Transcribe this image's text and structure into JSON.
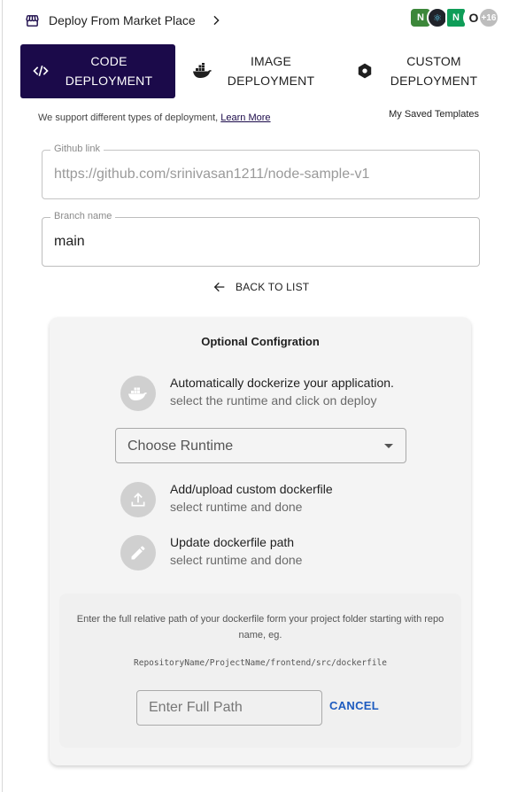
{
  "header": {
    "title": "Deploy From Market Place",
    "store_icon": "storefront-icon",
    "chevron_icon": "chevron-right-icon",
    "tech_badges": {
      "node": "N",
      "react": "⚛",
      "nginx": "N",
      "o": "O",
      "more": "+16"
    }
  },
  "tabs": [
    {
      "label": "Code Deployment",
      "icon": "code-icon",
      "active": true
    },
    {
      "label": "Image Deployment",
      "icon": "docker-icon",
      "active": false
    },
    {
      "label": "Custom Deployment",
      "icon": "hexagon-icon",
      "active": false
    }
  ],
  "support": {
    "text": "We support different types of deployment, ",
    "link": "Learn More"
  },
  "saved_templates": "My Saved Templates",
  "github_field": {
    "label": "Github link",
    "value": "https://github.com/srinivasan1211/node-sample-v1"
  },
  "branch_field": {
    "label": "Branch name",
    "value": "main"
  },
  "back_link": "BACK TO LIST",
  "optional": {
    "title": "Optional Configration",
    "options": [
      {
        "title": "Automatically dockerize your application.",
        "subtitle": "select the runtime and click on deploy",
        "icon": "docker-icon"
      },
      {
        "title": "Add/upload custom dockerfile",
        "subtitle": "select runtime and done",
        "icon": "upload-icon"
      },
      {
        "title": "Update dockerfile path",
        "subtitle": "select runtime and done",
        "icon": "pencil-icon"
      }
    ],
    "runtime_select": "Choose Runtime",
    "dockerfile_info": "Enter the full relative path of your dockerfile form your project folder starting with repo name, eg.",
    "example_path": "RepositoryName/ProjectName/frontend/src/dockerfile",
    "path_placeholder": "Enter Full Path",
    "cancel": "CANCEL"
  },
  "colors": {
    "primary": "#1b0a4a",
    "link_blue": "#1d5bbf",
    "card_bg": "#f4f4f4"
  }
}
